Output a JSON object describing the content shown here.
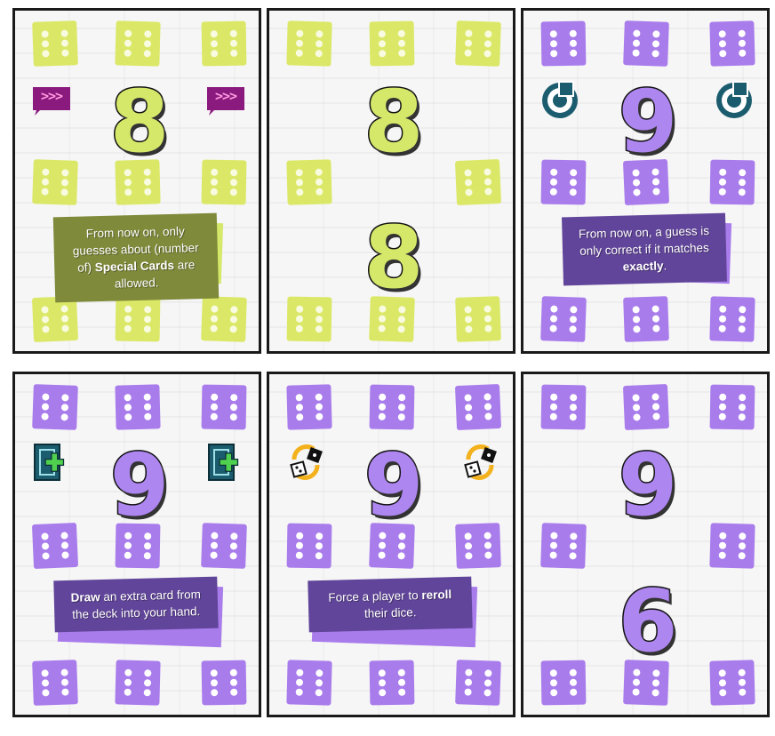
{
  "colors": {
    "yellow": "#d6e86a",
    "purple": "#a97cec",
    "olive": "#7f8a3a",
    "plum": "#61459a",
    "magenta": "#8a1a7d",
    "teal": "#1b5c6e",
    "green": "#4fd14f",
    "orange": "#f3b21d"
  },
  "cards": [
    {
      "number_top": "8",
      "number_bottom": "",
      "color": "yellow",
      "icon": "speech-arrows-icon",
      "icon_text": ">>>",
      "text": {
        "pre": "From now on, only guesses about (number of) ",
        "bold": "Special Cards",
        "post": " are allowed."
      }
    },
    {
      "number_top": "8",
      "number_bottom": "8",
      "color": "yellow",
      "icon": "",
      "icon_text": "",
      "text": null
    },
    {
      "number_top": "9",
      "number_bottom": "",
      "color": "purple",
      "icon": "target-icon",
      "icon_text": "",
      "text": {
        "pre": "From now on, a guess is only correct if it matches ",
        "bold": "exactly",
        "post": "."
      }
    },
    {
      "number_top": "9",
      "number_bottom": "",
      "color": "purple",
      "icon": "add-card-icon",
      "icon_text": "",
      "text": {
        "pre": "",
        "bold": "Draw",
        "post": " an extra card from the deck into your hand."
      }
    },
    {
      "number_top": "9",
      "number_bottom": "",
      "color": "purple",
      "icon": "reroll-dice-icon",
      "icon_text": "",
      "text": {
        "pre": "Force a player to ",
        "bold": "reroll",
        "post": " their dice."
      }
    },
    {
      "number_top": "9",
      "number_bottom": "6",
      "color": "purple",
      "icon": "",
      "icon_text": "",
      "text": null
    }
  ]
}
